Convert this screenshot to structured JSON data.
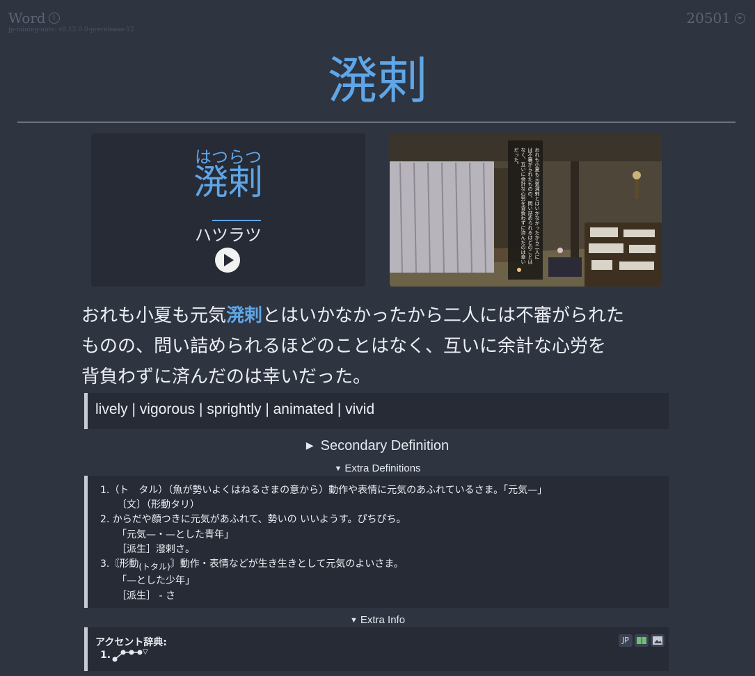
{
  "header": {
    "note_type": "Word",
    "version": "jp-mining-note: v0.12.0.0-prerelease-12",
    "card_id": "20501"
  },
  "word": {
    "headword": "溌剌",
    "furigana": "はつらつ",
    "reading_katakana": "ハツラツ"
  },
  "sentence": {
    "line1_before": "おれも小夏も元気",
    "line1_highlight": "溌剌",
    "line1_after": "とはいかなかったから二人には不審がられた",
    "line2": "ものの、問い詰められるほどのことはなく、互いに余計な心労を",
    "line3": "背負わずに済んだのは幸いだった。"
  },
  "screenshot": {
    "text_col1": "おれも小夏も元気溌剌とはいかなかったから二人に",
    "text_col2": "は不審がられたものの、問い詰められるほどのことは",
    "text_col3": "なく、互いに余計な心労を背負わずに済んだのは幸い",
    "text_col4": "だった。"
  },
  "primary_definition": "lively | vigorous | sprightly | animated | vivid",
  "secondary_definition_label": "Secondary Definition",
  "extra_definitions_label": "Extra Definitions",
  "extra_definitions": [
    "1.（ト　タル）（魚が勢いよくはねるさまの意から）動作や表情に元気のあふれているさま。「元気—」",
    "〔文〕（形動タリ）",
    "2. からだや顔つきに元気があふれて、勢いの いいようす。ぴちぴち。",
    "「元気—・—とした青年」",
    "［派生］潑剌さ。",
    "3.〘形動",
    "(トタル)",
    "〙動作・表情などが生き生きとして元気のよいさま。",
    "「—とした少年」",
    "［派生］ - さ"
  ],
  "extra_info_label": "Extra Info",
  "extra_info": {
    "heading": "アクセント辞典:",
    "item_number": "1.",
    "pitch_tail": "▽"
  },
  "tags": [
    "JP"
  ],
  "colors": {
    "background": "#2e3440",
    "accent": "#5ea6e8",
    "panel": "#262b35"
  }
}
